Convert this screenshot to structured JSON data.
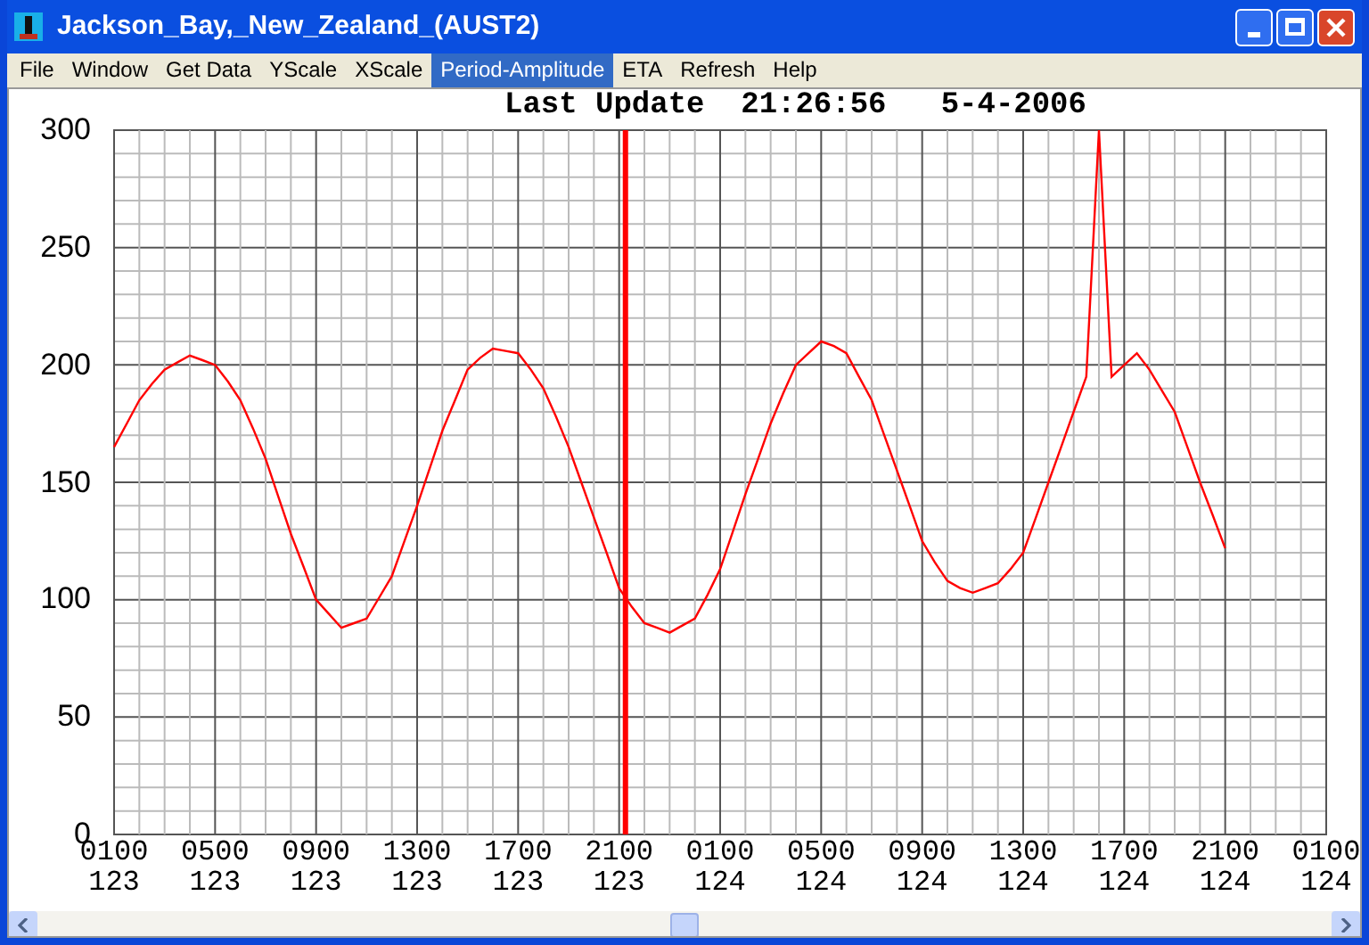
{
  "window": {
    "title": "Jackson_Bay,_New_Zealand_(AUST2)"
  },
  "menu": [
    {
      "label": "File",
      "selected": false
    },
    {
      "label": "Window",
      "selected": false
    },
    {
      "label": "Get Data",
      "selected": false
    },
    {
      "label": "YScale",
      "selected": false
    },
    {
      "label": "XScale",
      "selected": false
    },
    {
      "label": "Period-Amplitude",
      "selected": true
    },
    {
      "label": "ETA",
      "selected": false
    },
    {
      "label": "Refresh",
      "selected": false
    },
    {
      "label": "Help",
      "selected": false
    }
  ],
  "chart": {
    "header": "Last Update  21:26:56   5-4-2006",
    "chart_data": {
      "type": "line",
      "categories": [
        "0100 123",
        null,
        null,
        null,
        null,
        null,
        null,
        null,
        "0500 123",
        null,
        null,
        null,
        null,
        null,
        null,
        null,
        "0900 123",
        null,
        null,
        null,
        null,
        null,
        null,
        null,
        "1300 123",
        null,
        null,
        null,
        null,
        null,
        null,
        null,
        "1700 123",
        null,
        null,
        null,
        null,
        null,
        null,
        null,
        "2100 123",
        null,
        null,
        null,
        null,
        null,
        null,
        null,
        "0100 124",
        null,
        null,
        null,
        null,
        null,
        null,
        null,
        "0500 124",
        null,
        null,
        null,
        null,
        null,
        null,
        null,
        "0900 124",
        null,
        null,
        null,
        null,
        null,
        null,
        null,
        "1300 124",
        null,
        null,
        null,
        null,
        null,
        null,
        null,
        "1700 124",
        null,
        null,
        null,
        null,
        null,
        null,
        null,
        "2100 124",
        null,
        null,
        null,
        null,
        null,
        null,
        null,
        "0100 124"
      ],
      "series": [
        {
          "color": "#ff0000",
          "values": [
            165,
            175,
            185,
            192,
            198,
            201,
            204,
            202,
            200,
            193,
            185,
            173,
            160,
            144,
            128,
            114,
            100,
            94,
            88,
            90,
            92,
            101,
            110,
            125,
            140,
            156,
            172,
            185,
            198,
            203,
            207,
            206,
            205,
            198,
            190,
            178,
            165,
            150,
            135,
            120,
            105,
            97,
            90,
            88,
            86,
            89,
            92,
            102,
            113,
            129,
            145,
            160,
            175,
            188,
            200,
            205,
            210,
            208,
            205,
            195,
            185,
            170,
            155,
            140,
            125,
            116,
            108,
            105,
            103,
            105,
            107,
            113,
            120,
            135,
            150,
            165,
            180,
            195,
            300,
            195,
            200,
            205,
            198,
            189,
            180,
            165,
            150,
            136,
            122,
            null,
            null,
            null,
            null,
            null,
            null,
            null,
            null
          ]
        }
      ],
      "ylim": [
        0,
        300
      ],
      "grid": true,
      "yticks": [
        {
          "value": 0,
          "label": "0"
        },
        {
          "value": 50,
          "label": "50"
        },
        {
          "value": 100,
          "label": "100"
        },
        {
          "value": 150,
          "label": "150"
        },
        {
          "value": 200,
          "label": "200"
        },
        {
          "value": 250,
          "label": "250"
        },
        {
          "value": 300,
          "label": "300"
        }
      ]
    }
  }
}
